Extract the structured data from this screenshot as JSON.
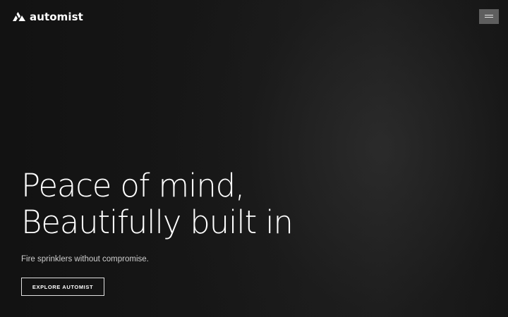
{
  "header": {
    "logo_text": "automist",
    "logo_icon": "automist-logo-icon",
    "menu_icon": "hamburger-menu-icon"
  },
  "hero": {
    "title_line_1": "Peace of mind,",
    "title_line_2": "Beautifully built in",
    "subtitle": "Fire sprinklers without compromise.",
    "cta_label": "EXPLORE AUTOMIST"
  },
  "colors": {
    "background": "#161616",
    "text": "#ffffff",
    "subtitle_text": "#cfcfcf",
    "menu_button_bg": "#5e5e5e"
  }
}
